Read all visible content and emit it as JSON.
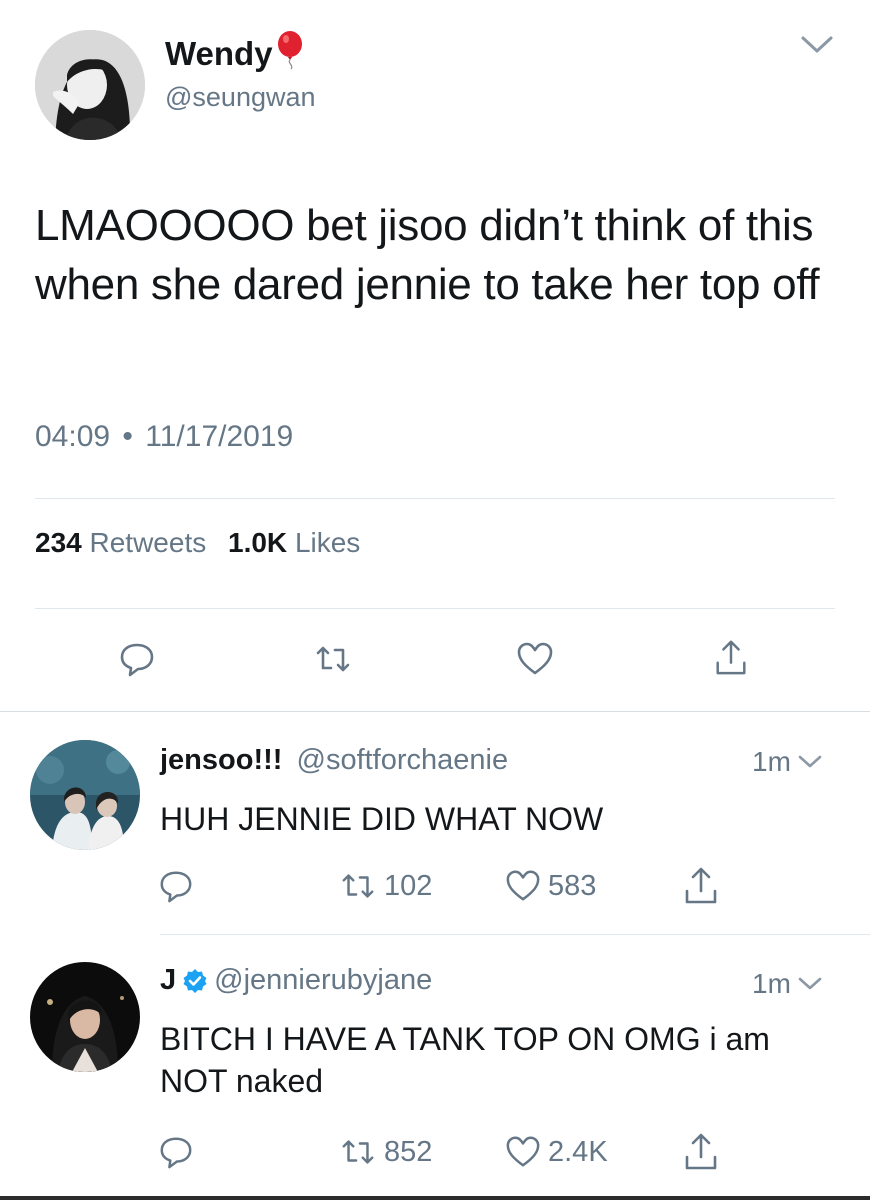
{
  "main_tweet": {
    "display_name": "Wendy",
    "name_emoji": "balloon-emoji",
    "handle": "@seungwan",
    "text": "LMAOOOOO bet jisoo didn’t think of this when she dared jennie to take her top off",
    "time": "04:09",
    "separator": "•",
    "date": "11/17/2019",
    "retweet_count": "234",
    "retweet_label": "Retweets",
    "like_count": "1.0K",
    "like_label": "Likes"
  },
  "replies": [
    {
      "display_name": "jensoo!!!",
      "handle": "@softforchaenie",
      "verified": false,
      "time": "1m",
      "text": "HUH JENNIE DID WHAT NOW",
      "retweets": "102",
      "likes": "583"
    },
    {
      "display_name": "J",
      "handle": "@jennierubyjane",
      "verified": true,
      "time": "1m",
      "text": "BITCH I HAVE A TANK TOP ON OMG i am NOT naked",
      "retweets": "852",
      "likes": "2.4K"
    }
  ],
  "icons": [
    "chevron-down-icon",
    "reply-icon",
    "retweet-icon",
    "like-icon",
    "share-icon",
    "verified-badge-icon"
  ],
  "colors": {
    "text_primary": "#14171a",
    "text_secondary": "#657786",
    "divider": "#e1e8ed",
    "verified_blue": "#1da1f2",
    "balloon_red": "#e0212f"
  }
}
